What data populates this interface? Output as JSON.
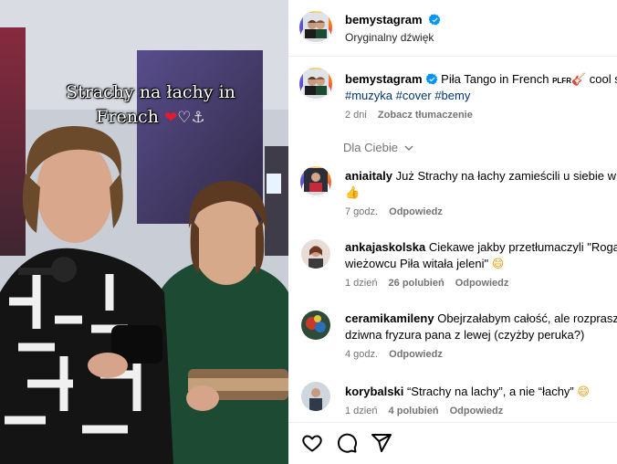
{
  "video": {
    "overlay_line1": "Strachy na łachy in",
    "overlay_line2": "French",
    "overlay_emoji_red_heart": "❤",
    "overlay_emoji_white_heart": "♡",
    "overlay_emoji_anchor": "⚓"
  },
  "post": {
    "author": "bemystagram",
    "audio": "Oryginalny dźwięk",
    "caption_prefix": "Piła Tango in French",
    "caption_tag": "PLFR",
    "caption_suffix": "cool s",
    "hashtags": [
      "#muzyka",
      "#cover",
      "#bemy"
    ],
    "time": "2 dni",
    "translate": "Zobacz tłumaczenie"
  },
  "section_label": "Dla Ciebie",
  "comments": [
    {
      "user": "aniaitaly",
      "line1": "Już Strachy na łachy zamieścili u siebie w s",
      "line2": "👍",
      "time": "7 godz.",
      "likes": "",
      "reply": "Odpowiedz"
    },
    {
      "user": "ankajaskolska",
      "line1": "Ciekawe jakby przetłumaczyli \"Rogac",
      "line2": "wieżowcu Piła witała jeleni\"",
      "line2_emoji": "😄",
      "time": "1 dzień",
      "likes": "26 polubień",
      "reply": "Odpowiedz"
    },
    {
      "user": "ceramikamileny",
      "line1": "Obejrzałabym całość, ale rozprasza",
      "line2": "dziwna fryzura pana z lewej (czyżby peruka?)",
      "time": "4 godz.",
      "likes": "",
      "reply": "Odpowiedz"
    },
    {
      "user": "korybalski",
      "line1": "“Strachy na lachy”, a nie “łachy”",
      "line1_emoji": "😄",
      "time": "1 dzień",
      "likes": "4 polubień",
      "reply": "Odpowiedz"
    }
  ],
  "icons": {
    "like": "heart-icon",
    "comment": "comment-icon",
    "share": "share-icon",
    "verified": "verified-badge-icon",
    "chevron": "chevron-down-icon"
  },
  "colors": {
    "verified_blue": "#0095f6",
    "meta_gray": "#737373",
    "hashtag_blue": "#00376b"
  }
}
